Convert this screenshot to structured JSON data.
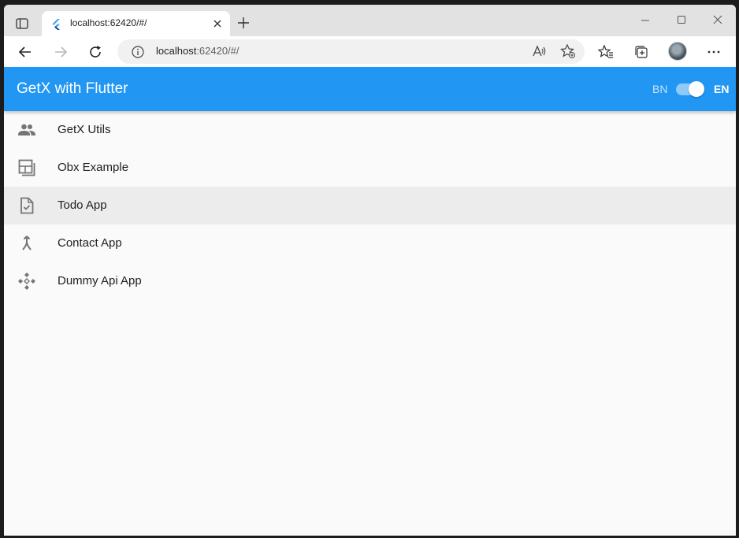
{
  "browser": {
    "tab": {
      "title": "localhost:62420/#/"
    },
    "address": {
      "host": "localhost",
      "rest": ":62420/#/"
    }
  },
  "appbar": {
    "title": "GetX with Flutter",
    "lang_left": "BN",
    "lang_right": "EN",
    "toggle_on": true
  },
  "list": {
    "items": [
      {
        "label": "GetX Utils",
        "icon": "people-icon"
      },
      {
        "label": "Obx Example",
        "icon": "dashboard-icon"
      },
      {
        "label": "Todo App",
        "icon": "task-file-icon"
      },
      {
        "label": "Contact App",
        "icon": "merge-icon"
      },
      {
        "label": "Dummy Api App",
        "icon": "api-icon"
      }
    ]
  },
  "colors": {
    "appbar": "#2196f3",
    "hover": "#ececec"
  }
}
